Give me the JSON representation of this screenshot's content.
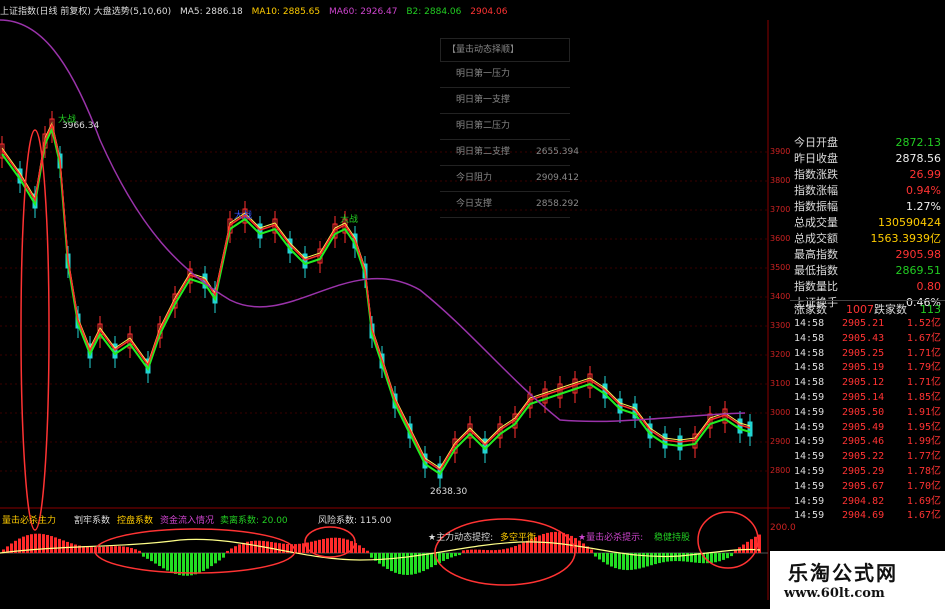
{
  "header": {
    "title": "上证指数(日线 前复权) 大盘选势(5,10,60)",
    "ma5": "MA5: 2886.18",
    "ma10": "MA10: 2885.65",
    "ma60": "MA60: 2926.47",
    "b2": "B2: 2884.06",
    "extra": "2904.06"
  },
  "overlay": {
    "title": "【量击动态择顺】",
    "rows": [
      {
        "label": "明日第一压力",
        "value": ""
      },
      {
        "label": "明日第一支撑",
        "value": ""
      },
      {
        "label": "明日第二压力",
        "value": ""
      },
      {
        "label": "明日第二支撑",
        "value": "2655.394"
      },
      {
        "label": "今日阻力",
        "value": "2909.412"
      },
      {
        "label": "今日支撑",
        "value": "2858.292"
      }
    ]
  },
  "quote": {
    "rows": [
      {
        "label": "今日开盘",
        "value": "2872.13",
        "color": "#22cc22"
      },
      {
        "label": "昨日收盘",
        "value": "2878.56",
        "color": "#eeeeee"
      },
      {
        "label": "指数涨跌",
        "value": "26.99",
        "color": "#ff3333"
      },
      {
        "label": "指数涨幅",
        "value": "0.94%",
        "color": "#ff3333"
      },
      {
        "label": "指数振幅",
        "value": "1.27%",
        "color": "#eeeeee"
      },
      {
        "label": "总成交量",
        "value": "130590424",
        "color": "#ffcc00"
      },
      {
        "label": "总成交额",
        "value": "1563.3939亿",
        "color": "#ffcc00"
      },
      {
        "label": "最高指数",
        "value": "2905.98",
        "color": "#ff3333"
      },
      {
        "label": "最低指数",
        "value": "2869.51",
        "color": "#22cc22"
      },
      {
        "label": "指数量比",
        "value": "0.80",
        "color": "#ff3333"
      },
      {
        "label": "上证换手",
        "value": "0.46%",
        "color": "#eeeeee"
      }
    ],
    "up_label": "涨家数",
    "up_count": "1007",
    "down_label": "跌家数",
    "down_count": "113"
  },
  "trades": [
    {
      "time": "14:58",
      "price": "2905.21",
      "vol": "1.52亿"
    },
    {
      "time": "14:58",
      "price": "2905.43",
      "vol": "1.67亿"
    },
    {
      "time": "14:58",
      "price": "2905.25",
      "vol": "1.71亿"
    },
    {
      "time": "14:58",
      "price": "2905.19",
      "vol": "1.79亿"
    },
    {
      "time": "14:58",
      "price": "2905.12",
      "vol": "1.71亿"
    },
    {
      "time": "14:59",
      "price": "2905.14",
      "vol": "1.85亿"
    },
    {
      "time": "14:59",
      "price": "2905.50",
      "vol": "1.91亿"
    },
    {
      "time": "14:59",
      "price": "2905.49",
      "vol": "1.95亿"
    },
    {
      "time": "14:59",
      "price": "2905.46",
      "vol": "1.99亿"
    },
    {
      "time": "14:59",
      "price": "2905.22",
      "vol": "1.77亿"
    },
    {
      "time": "14:59",
      "price": "2905.29",
      "vol": "1.78亿"
    },
    {
      "time": "14:59",
      "price": "2905.67",
      "vol": "1.70亿"
    },
    {
      "time": "14:59",
      "price": "2904.82",
      "vol": "1.69亿"
    },
    {
      "time": "14:59",
      "price": "2904.69",
      "vol": "1.67亿"
    }
  ],
  "indicator": {
    "name": "量击必杀主力",
    "coef1": "割牢系数",
    "coef2": "控盘系数",
    "coef3": "资金流入情况",
    "coef4": "卖离系数: 20.00",
    "risk": "风险系数: 115.00",
    "status_title": "★主力动态提控:",
    "status_value": "多空平衡",
    "hint_title": "★量击必杀提示:",
    "hint_value": "稳健持股",
    "axis_value": "200.0"
  },
  "price_labels": {
    "high": "3966.34",
    "low": "2638.30",
    "tag1": "大战",
    "tag2": "大战",
    "tag3": "大战"
  },
  "axis_labels": [
    "3900",
    "3800",
    "3700",
    "3600",
    "3500",
    "3400",
    "3300",
    "3200",
    "3100",
    "3000",
    "2900",
    "2800"
  ],
  "brand": {
    "name": "乐淘公式网",
    "url": "www.60lt.com"
  }
}
